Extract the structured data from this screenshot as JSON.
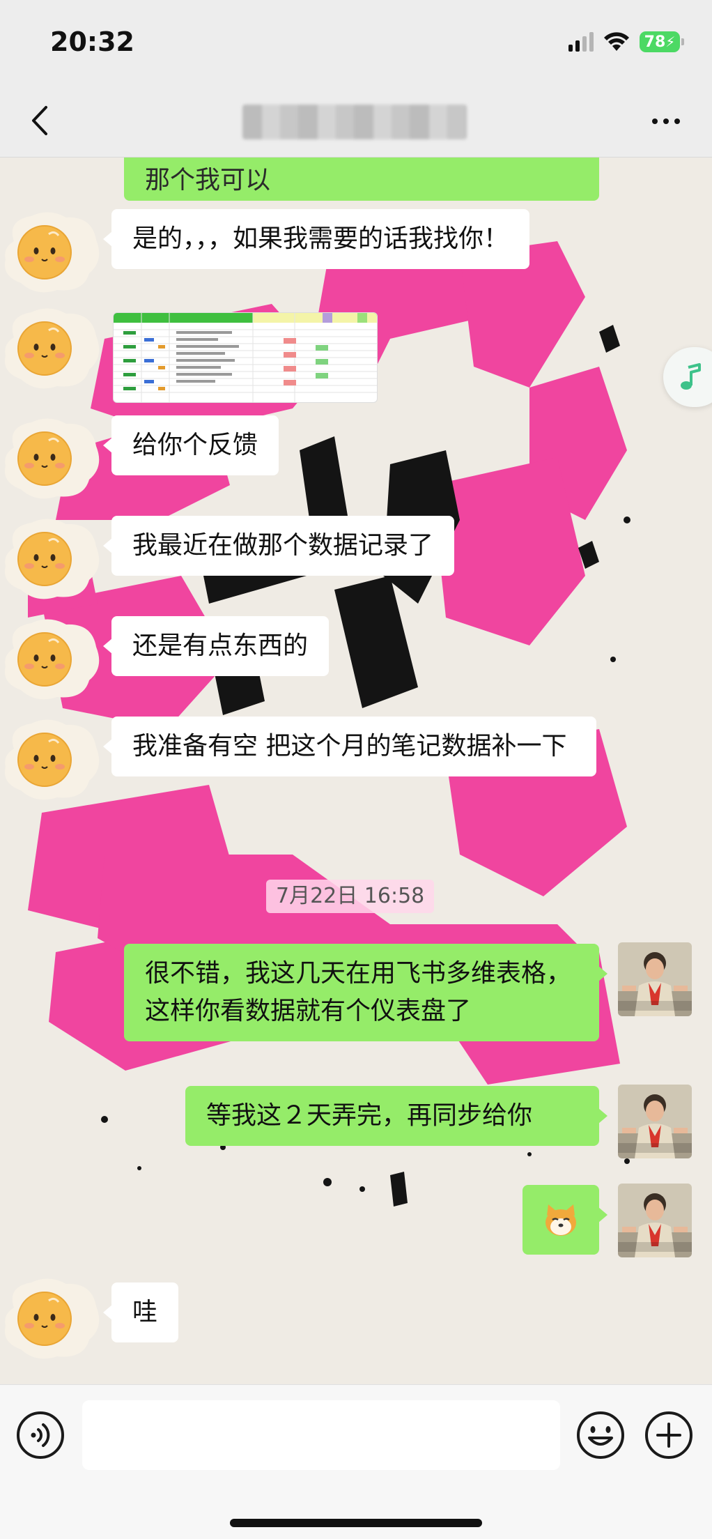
{
  "status_bar": {
    "time": "20:32",
    "battery": "78"
  },
  "nav": {
    "back_icon": "chevron-left-icon",
    "more_icon": "more-dots-icon"
  },
  "messages": [
    {
      "side": "out",
      "text": "那个我可以"
    },
    {
      "side": "in",
      "text": "是的，，，如果我需要的话我找你！"
    },
    {
      "side": "in",
      "type": "image",
      "text": ""
    },
    {
      "side": "in",
      "text": "给你个反馈"
    },
    {
      "side": "in",
      "text": "我最近在做那个数据记录了"
    },
    {
      "side": "in",
      "text": "还是有点东西的"
    },
    {
      "side": "in",
      "text": "我准备有空 把这个月的笔记数据补一下"
    },
    {
      "side": "out",
      "text": "很不错，我这几天在用飞书多维表格，这样你看数据就有个仪表盘了"
    },
    {
      "side": "out",
      "text": "等我这２天弄完，再同步给你"
    },
    {
      "side": "out",
      "type": "sticker",
      "text": ""
    },
    {
      "side": "in",
      "text": "哇"
    }
  ],
  "timestamp": "7月22日 16:58",
  "input": {
    "value": "",
    "voice_icon": "voice-icon",
    "emoji_icon": "emoji-icon",
    "plus_icon": "plus-icon"
  },
  "colors": {
    "outgoing_bubble": "#95ec69",
    "incoming_bubble": "#ffffff",
    "wallpaper_ink": "#f0459f"
  }
}
